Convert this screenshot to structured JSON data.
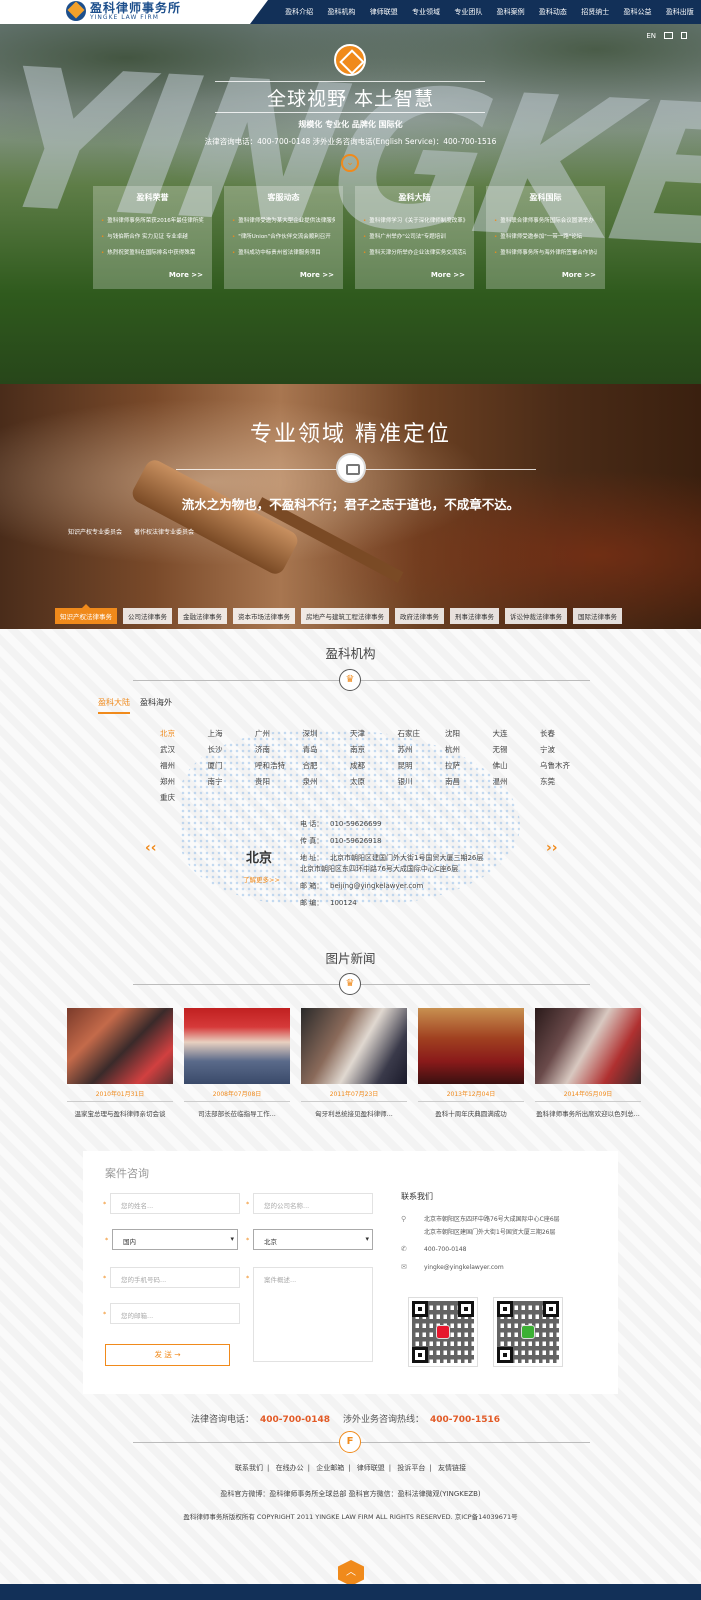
{
  "header": {
    "logo_cn": "盈科律师事务所",
    "logo_en": "YINGKE LAW FIRM",
    "nav": [
      "盈科介绍",
      "盈科机构",
      "律师联盟",
      "专业领域",
      "专业团队",
      "盈科案例",
      "盈科动态",
      "招贤纳士",
      "盈科公益",
      "盈科出版"
    ]
  },
  "hero": {
    "lang_en": "EN",
    "title": "全球视野 本土智慧",
    "subtitle": "规模化 专业化 品牌化 国际化",
    "phone": "法律咨询电话：400-700-0148 涉外业务咨询电话(English Service)：400-700-1516",
    "cards": [
      {
        "title": "盈科荣誉",
        "items": [
          "盈科律师事务所荣获2016年最佳律所奖项",
          "与钱伯斯合作 实力见证 专业卓越",
          "热烈祝贺盈科在国际排名中获得殊荣"
        ],
        "more": "More >>"
      },
      {
        "title": "客服动态",
        "items": [
          "盈科律师受邀为某大型企业提供法律服务",
          "\"律所Union\"合作伙伴交流会顺利召开",
          "盈科成功中标贵州省法律服务项目"
        ],
        "more": "More >>"
      },
      {
        "title": "盈科大陆",
        "items": [
          "盈科律师学习《关于深化律师制度改革》",
          "盈科广州举办\"公司法\"专题培训",
          "盈科天津分所举办企业法律实务交流活动"
        ],
        "more": "More >>"
      },
      {
        "title": "盈科国际",
        "items": [
          "盈科联合律师事务所国际会议圆满举办",
          "盈科律师受邀参加\"一带一路\"论坛",
          "盈科律师事务所与海外律所签署合作协议"
        ],
        "more": "More >>"
      }
    ]
  },
  "practice": {
    "title": "专业领域 精准定位",
    "quote": "流水之为物也，不盈科不行；君子之志于道也，不成章不达。",
    "sublinks": [
      "知识产权专业委员会",
      "著作权法律专业委员会"
    ],
    "tags": [
      "知识产权法律事务",
      "公司法律事务",
      "金融法律事务",
      "资本市场法律事务",
      "房地产与建筑工程法律事务",
      "政府法律事务",
      "刑事法律事务",
      "诉讼仲裁法律事务",
      "国际法律事务"
    ]
  },
  "offices": {
    "title": "盈科机构",
    "tabs": [
      "盈科大陆",
      "盈科海外"
    ],
    "cities": [
      "北京",
      "上海",
      "广州",
      "深圳",
      "天津",
      "石家庄",
      "沈阳",
      "大连",
      "长春",
      "武汉",
      "长沙",
      "济南",
      "青岛",
      "南京",
      "苏州",
      "杭州",
      "无锡",
      "宁波",
      "福州",
      "厦门",
      "呼和浩特",
      "合肥",
      "成都",
      "昆明",
      "拉萨",
      "佛山",
      "乌鲁木齐",
      "郑州",
      "南宁",
      "贵阳",
      "泉州",
      "太原",
      "银川",
      "南昌",
      "温州",
      "东莞",
      "重庆"
    ],
    "selected_name": "北京",
    "more": "了解更多>>",
    "info": [
      {
        "label": "电  话：",
        "value": "010-59626699"
      },
      {
        "label": "传  真：",
        "value": "010-59626918"
      },
      {
        "label": "地  址：",
        "value": "北京市朝阳区建国门外大街1号国贸大厦三期26层"
      },
      {
        "label": "",
        "value": "北京市朝阳区东四环中路76号大成国际中心C座6层"
      },
      {
        "label": "邮  箱：",
        "value": "beijing@yingkelawyer.com"
      },
      {
        "label": "邮  编：",
        "value": "100124"
      }
    ]
  },
  "news": {
    "title": "图片新闻",
    "items": [
      {
        "date": "2010年01月31日",
        "caption": "温家宝总理与盈科律师亲切会谈"
      },
      {
        "date": "2008年07月08日",
        "caption": "司法部部长莅临指导工作..."
      },
      {
        "date": "2011年07月23日",
        "caption": "匈牙利总统接见盈科律师..."
      },
      {
        "date": "2013年12月04日",
        "caption": "盈科十周年庆典圆满成功"
      },
      {
        "date": "2014年05月09日",
        "caption": "盈科律师事务所出席欢迎以色列总..."
      }
    ]
  },
  "form": {
    "title": "案件咨询",
    "name_ph": "您的姓名...",
    "company_ph": "您的公司名称...",
    "country": "国内",
    "city": "北京",
    "phone_ph": "您的手机号码...",
    "desc_ph": "案件概述...",
    "email_ph": "您的邮箱...",
    "send": "发 送 →",
    "contact_title": "联系我们",
    "address1": "北京市朝阳区东四环中路76号大成国际中心C座6层",
    "address2": "北京市朝阳区建国门外大街1号国贸大厦三期26层",
    "phone": "400-700-0148",
    "email": "yingke@yingkelawyer.com"
  },
  "footer": {
    "hotline_label1": "法律咨询电话：",
    "hotline1": "400-700-0148",
    "hotline_label2": "涉外业务咨询热线：",
    "hotline2": "400-700-1516",
    "links": [
      "联系我们",
      "在线办公",
      "企业邮箱",
      "律师联盟",
      "投诉平台",
      "友情链接"
    ],
    "sites": "盈科官方微博：盈科律师事务所全球总部   盈科官方微信：盈科法律微观(YINGKEZB)",
    "copyright": "盈科律师事务所版权所有 COPYRIGHT 2011 YINGKE LAW FIRM ALL RIGHTS RESERVED. 京ICP备14039671号"
  },
  "colors": {
    "accent": "#f08a1b",
    "navy": "#123058",
    "brand": "#1d4f8c"
  }
}
